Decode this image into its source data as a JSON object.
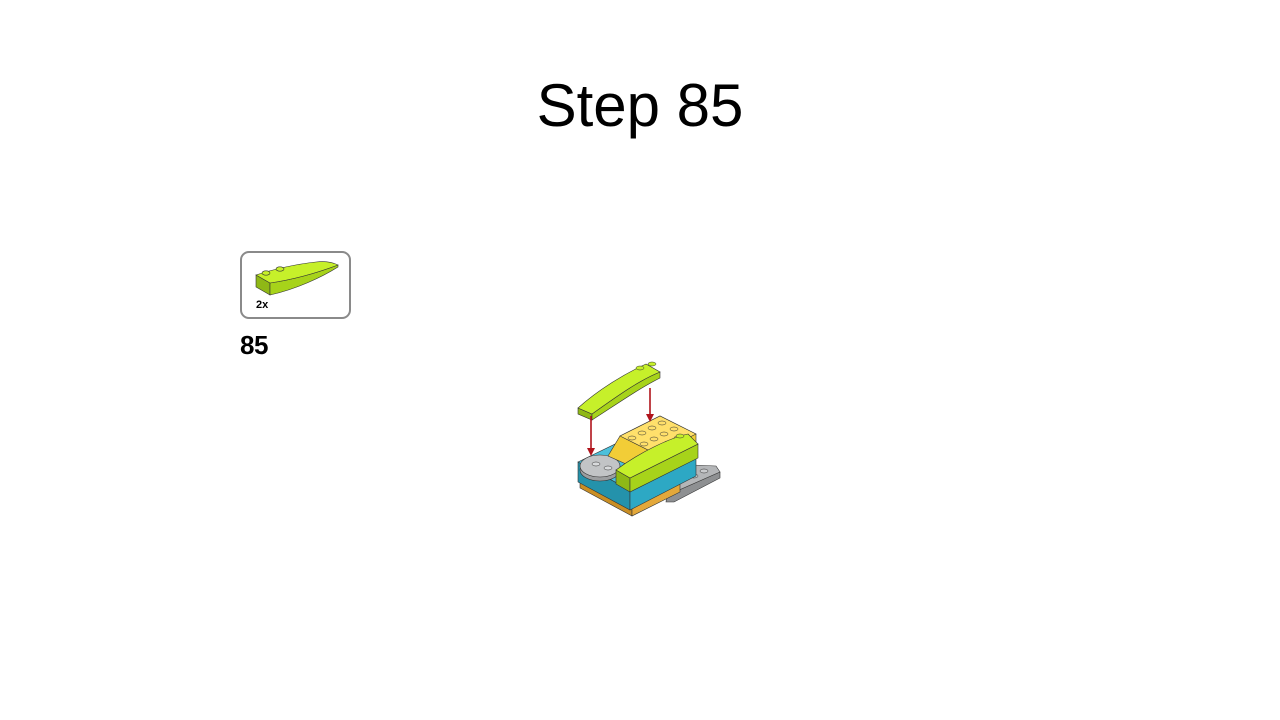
{
  "slide": {
    "title": "Step 85"
  },
  "parts_list": {
    "items": [
      {
        "part": "lime-curved-slope-brick",
        "color": "#B5E61D",
        "quantity": "2x"
      }
    ]
  },
  "step": {
    "number": "85"
  },
  "colors": {
    "lime": "#B5E61D",
    "yellow": "#F2CD37",
    "teal": "#2DA8C4",
    "orange": "#E3A83A",
    "gray": "#A8AAAC",
    "arrow": "#B0141C"
  }
}
